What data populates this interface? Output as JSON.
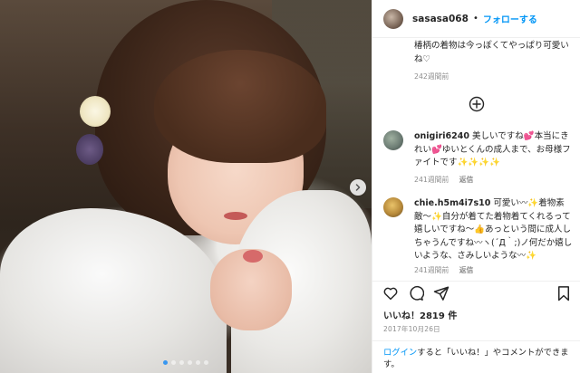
{
  "post": {
    "username": "sasasa068",
    "separator": "•",
    "follow_label": "フォローする"
  },
  "photo": {
    "carousel_total": 6,
    "carousel_active": 1
  },
  "comments": {
    "top": {
      "text": "椿柄の着物は今っぽくてやっぱり可愛いね♡",
      "time": "242週間前"
    },
    "load_more_icon": "plus-circle-icon",
    "items": [
      {
        "username": "onigiri6240",
        "text": "美しいですね💕本当にきれい💕ゆいとくんの成人まで、お母様ファイトです✨✨✨✨",
        "time": "241週間前",
        "reply": "返信"
      },
      {
        "username": "chie.h5m4i7s10",
        "text": "可愛い〰✨着物素敵〜✨自分が着てた着物着てくれるって嬉しいですね〜👍あっという間に成人しちゃうんですね〰ヽ(´Д｀;)ノ何だか嬉しいような、さみしいような〰✨",
        "time": "241週間前",
        "reply": "返信"
      }
    ]
  },
  "actions": {
    "like_icon": "heart-icon",
    "comment_icon": "comment-icon",
    "share_icon": "share-icon",
    "save_icon": "bookmark-icon"
  },
  "likes_label": "いいね！2819 件",
  "date_label": "2017年10月26日",
  "login_prompt": {
    "link": "ログイン",
    "text": "すると「いいね！」やコメントができます。"
  },
  "colors": {
    "accent": "#0095f6",
    "muted": "#8e8e8e",
    "text": "#262626"
  }
}
